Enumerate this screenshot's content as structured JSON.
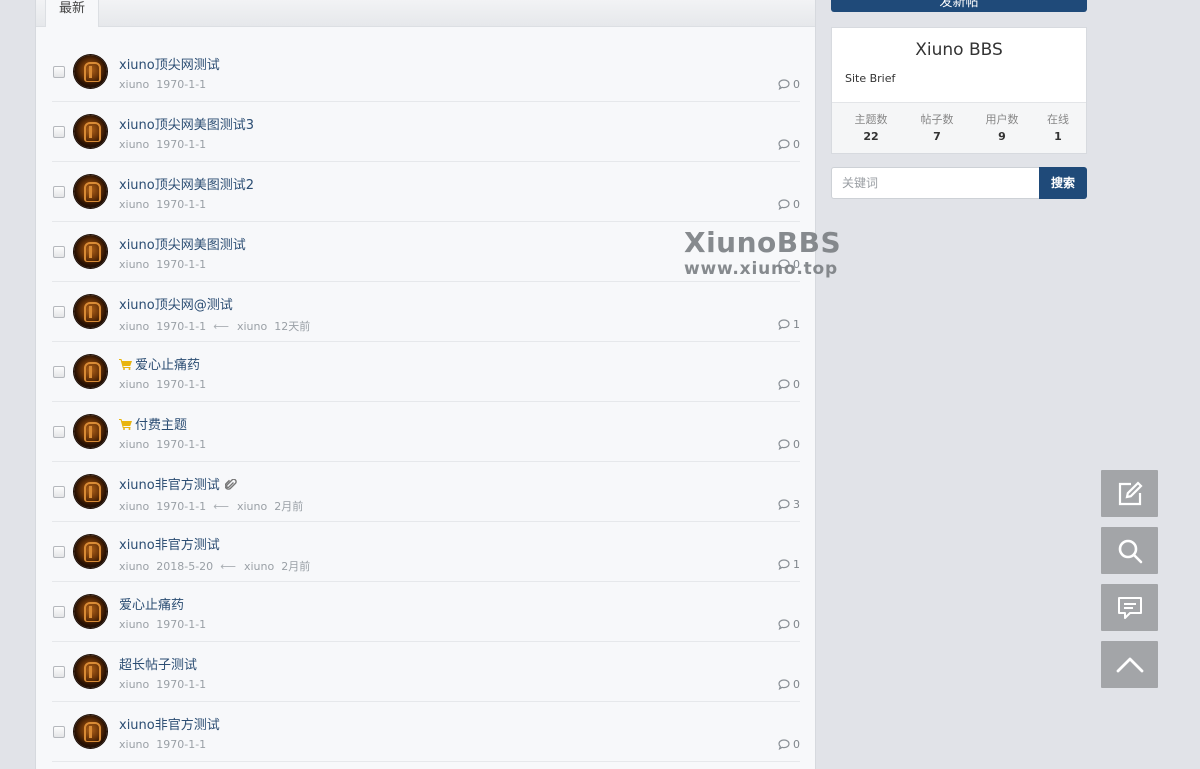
{
  "tabs": {
    "active_label": "最新"
  },
  "threads": [
    {
      "subject": "xiuno顶尖网测试",
      "author": "xiuno",
      "date": "1970-1-1",
      "last_user": "",
      "last_time": "",
      "replies": "0",
      "paid": false,
      "attachment": false
    },
    {
      "subject": "xiuno顶尖网美图测试3",
      "author": "xiuno",
      "date": "1970-1-1",
      "last_user": "",
      "last_time": "",
      "replies": "0",
      "paid": false,
      "attachment": false
    },
    {
      "subject": "xiuno顶尖网美图测试2",
      "author": "xiuno",
      "date": "1970-1-1",
      "last_user": "",
      "last_time": "",
      "replies": "0",
      "paid": false,
      "attachment": false
    },
    {
      "subject": "xiuno顶尖网美图测试",
      "author": "xiuno",
      "date": "1970-1-1",
      "last_user": "",
      "last_time": "",
      "replies": "0",
      "paid": false,
      "attachment": false
    },
    {
      "subject": "xiuno顶尖网@测试",
      "author": "xiuno",
      "date": "1970-1-1",
      "last_user": "xiuno",
      "last_time": "12天前",
      "replies": "1",
      "paid": false,
      "attachment": false
    },
    {
      "subject": "爱心止痛药",
      "author": "xiuno",
      "date": "1970-1-1",
      "last_user": "",
      "last_time": "",
      "replies": "0",
      "paid": true,
      "attachment": false
    },
    {
      "subject": "付费主题",
      "author": "xiuno",
      "date": "1970-1-1",
      "last_user": "",
      "last_time": "",
      "replies": "0",
      "paid": true,
      "attachment": false
    },
    {
      "subject": "xiuno非官方测试",
      "author": "xiuno",
      "date": "1970-1-1",
      "last_user": "xiuno",
      "last_time": "2月前",
      "replies": "3",
      "paid": false,
      "attachment": true
    },
    {
      "subject": "xiuno非官方测试",
      "author": "xiuno",
      "date": "2018-5-20",
      "last_user": "xiuno",
      "last_time": "2月前",
      "replies": "1",
      "paid": false,
      "attachment": false
    },
    {
      "subject": "爱心止痛药",
      "author": "xiuno",
      "date": "1970-1-1",
      "last_user": "",
      "last_time": "",
      "replies": "0",
      "paid": false,
      "attachment": false
    },
    {
      "subject": "超长帖子测试",
      "author": "xiuno",
      "date": "1970-1-1",
      "last_user": "",
      "last_time": "",
      "replies": "0",
      "paid": false,
      "attachment": false
    },
    {
      "subject": "xiuno非官方测试",
      "author": "xiuno",
      "date": "1970-1-1",
      "last_user": "",
      "last_time": "",
      "replies": "0",
      "paid": false,
      "attachment": false
    }
  ],
  "sidebar": {
    "new_thread_label": "发新帖",
    "site_name": "Xiuno BBS",
    "site_brief": "Site Brief",
    "stats": [
      {
        "label": "主题数",
        "value": "22"
      },
      {
        "label": "帖子数",
        "value": "7"
      },
      {
        "label": "用户数",
        "value": "9"
      },
      {
        "label": "在线",
        "value": "1"
      }
    ],
    "search_placeholder": "关键词",
    "search_button": "搜索"
  },
  "watermark": {
    "title": "XiunoBBS",
    "url": "www.xiuno.top"
  },
  "float_tools": [
    "new-thread-icon",
    "search-icon",
    "comment-icon",
    "back-to-top-icon"
  ],
  "colors": {
    "brand": "#1f4a79",
    "link": "#2b4d73",
    "float_bg": "#a3a5a8",
    "paid_icon": "#e8b40e"
  }
}
